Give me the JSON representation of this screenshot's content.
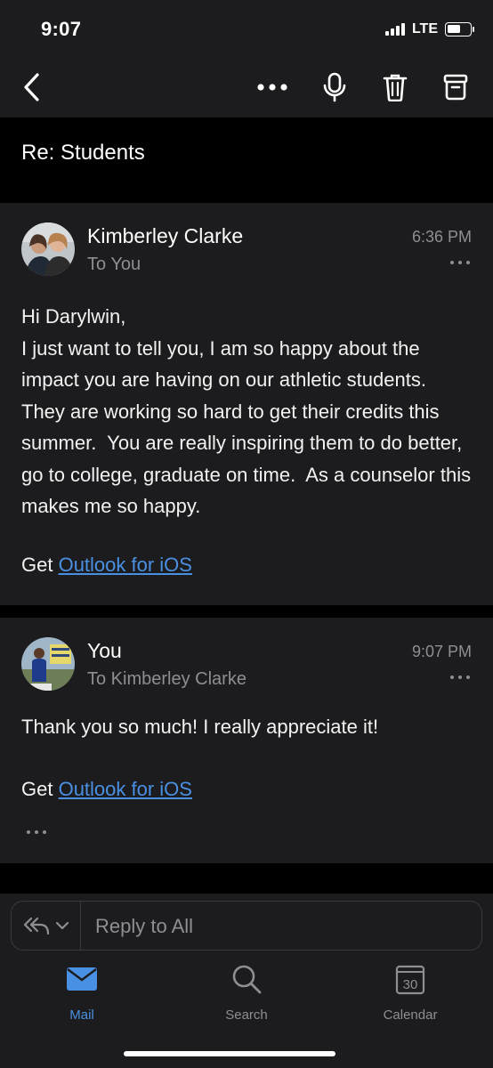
{
  "status": {
    "time": "9:07",
    "network": "LTE",
    "battery_level": 0.6,
    "signal_bars": 4
  },
  "toolbar": {
    "back_icon": "chevron-left-icon",
    "more_icon": "more-horizontal-icon",
    "mic_icon": "microphone-icon",
    "delete_icon": "trash-icon",
    "archive_icon": "archive-icon"
  },
  "subject": "Re: Students",
  "messages": [
    {
      "sender": "Kimberley Clarke",
      "recipient": "To You",
      "time": "6:36 PM",
      "body": "Hi Darylwin,\nI just want to tell you, I am so happy about the impact you are having on our athletic students.  They are working so hard to get their credits this summer.  You are really inspiring them to do better, go to college, graduate on time.  As a counselor this makes me so happy.",
      "signature_prefix": "Get ",
      "signature_link": "Outlook for iOS"
    },
    {
      "sender": "You",
      "recipient": "To Kimberley Clarke",
      "time": "9:07 PM",
      "body": "Thank you so much! I really appreciate it!",
      "signature_prefix": "Get ",
      "signature_link": "Outlook for iOS"
    }
  ],
  "reply": {
    "placeholder": "Reply to All"
  },
  "tabs": [
    {
      "label": "Mail",
      "icon": "mail-icon",
      "active": true
    },
    {
      "label": "Search",
      "icon": "search-icon",
      "active": false
    },
    {
      "label": "Calendar",
      "icon": "calendar-icon",
      "active": false,
      "badge": "30"
    }
  ],
  "colors": {
    "accent": "#4a90e2",
    "surface": "#1c1c1e",
    "background": "#000000",
    "secondary_text": "#8e8e93"
  }
}
